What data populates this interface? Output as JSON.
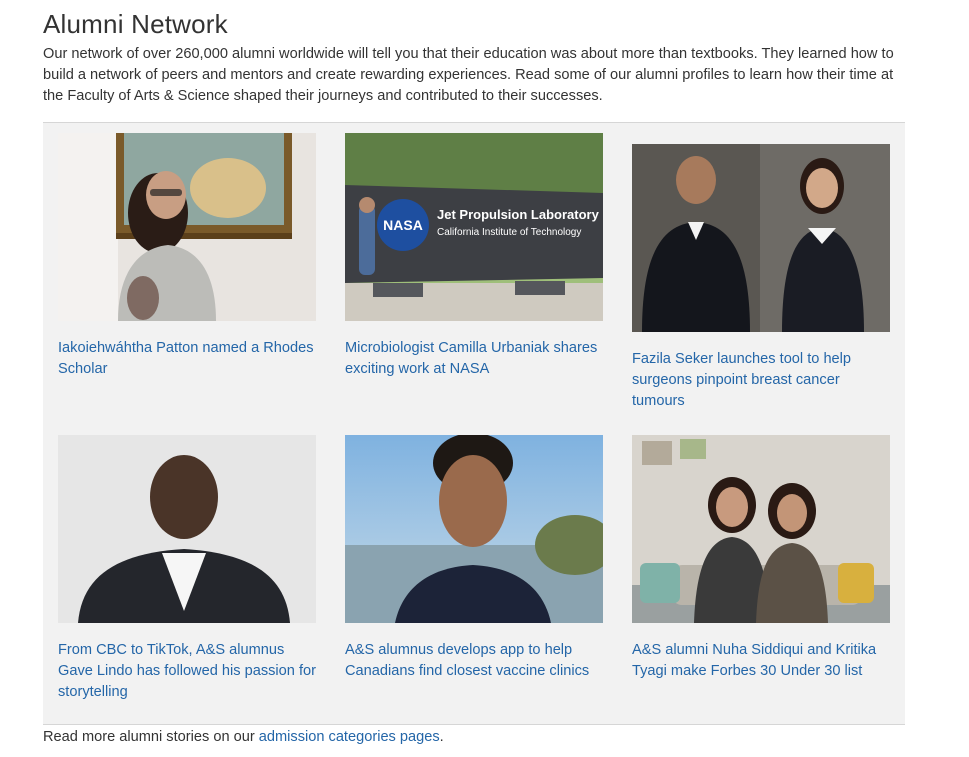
{
  "section": {
    "title": "Alumni Network",
    "intro": "Our network of over 260,000 alumni worldwide will tell you that their education was about more than textbooks. They learned how to build a network of peers and mentors and create rewarding experiences. Read some of our alumni profiles to learn how their time at the Faculty of Arts & Science shaped their journeys and contributed to their successes."
  },
  "cards": [
    {
      "caption": "Iakoiehwáhtha Patton named a Rhodes Scholar"
    },
    {
      "caption": "Microbiologist Camilla Urbaniak shares exciting work at NASA",
      "sign_brand": "NASA",
      "sign_line1": "Jet Propulsion Laboratory",
      "sign_line2": "California Institute of Technology"
    },
    {
      "caption": "Fazila Seker launches tool to help surgeons pinpoint breast cancer tumours"
    },
    {
      "caption": "From CBC to TikTok, A&S alumnus Gave Lindo has followed his passion for storytelling"
    },
    {
      "caption": "A&S alumnus develops app to help Canadians find closest vaccine clinics"
    },
    {
      "caption": "A&S alumni Nuha Siddiqui and Kritika Tyagi make Forbes 30 Under 30 list"
    }
  ],
  "footer": {
    "prefix": "Read more alumni stories on our ",
    "link": "admission categories pages",
    "suffix": "."
  }
}
